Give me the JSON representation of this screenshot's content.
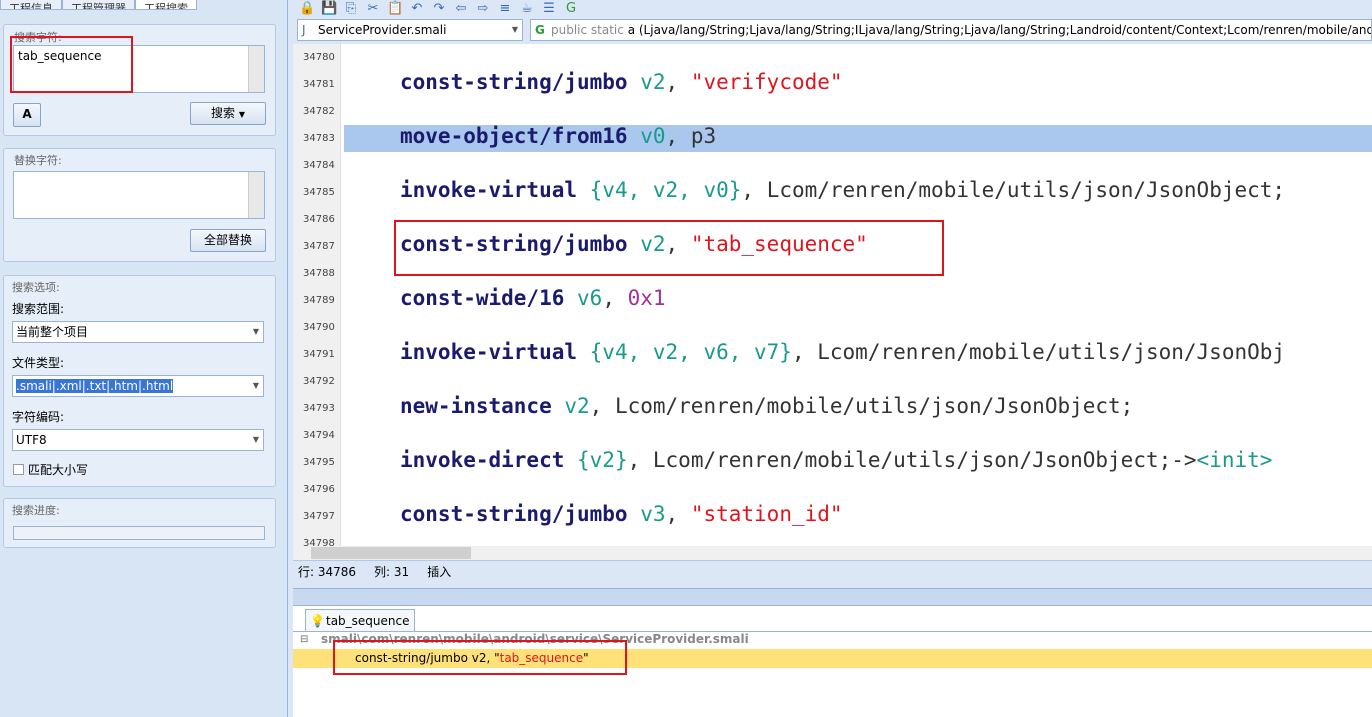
{
  "left_tabs": [
    "工程信息",
    "工程管理器",
    "工程搜索"
  ],
  "search": {
    "label": "搜索字符:",
    "value": "tab_sequence",
    "button": "搜索",
    "case_icon": "font-size-icon"
  },
  "replace": {
    "label": "替换字符:",
    "value": "",
    "button": "全部替换"
  },
  "options": {
    "label": "搜索选项:",
    "scope_label": "搜索范围:",
    "scope_value": "当前整个项目",
    "type_label": "文件类型:",
    "type_value": ".smali|.xml|.txt|.htm|.html",
    "encoding_label": "字符编码:",
    "encoding_value": "UTF8",
    "match_case": "匹配大小写"
  },
  "progress": {
    "label": "搜索进度:",
    "value": 0
  },
  "editor": {
    "file": "ServiceProvider.smali",
    "method_prefix": "public static",
    "method": "a (Ljava/lang/String;Ljava/lang/String;ILjava/lang/String;Ljava/lang/String;Landroid/content/Context;Lcom/renren/mobile/android/",
    "line_numbers": [
      "34780",
      "34781",
      "34782",
      "34783",
      "34784",
      "34785",
      "34786",
      "34787",
      "34788",
      "34789",
      "34790",
      "34791",
      "34792",
      "34793",
      "34794",
      "34795",
      "34796",
      "34797",
      "34798"
    ],
    "lines": [
      {
        "op": "const-string/jumbo",
        "a": " v2",
        ",": ", ",
        "s": "\"verifycode\""
      },
      {
        "op": "move-object/from16",
        "a": " v0",
        ",": ", ",
        "p": "p3"
      },
      {
        "op": "invoke-virtual",
        "b": " {v4, v2, v0}",
        ",": ", ",
        "p": "Lcom/renren/mobile/utils/json/JsonObject;"
      },
      {
        "op": "const-string/jumbo",
        "a": " v2",
        ",": ", ",
        "s": "\"tab_sequence\""
      },
      {
        "op": "const-wide/16",
        "a": " v6",
        ",": ", ",
        "n": "0x1"
      },
      {
        "op": "invoke-virtual",
        "b": " {v4, v2, v6, v7}",
        ",": ", ",
        "p": "Lcom/renren/mobile/utils/json/JsonObj"
      },
      {
        "op": "new-instance",
        "a": " v2",
        ",": ", ",
        "p": "Lcom/renren/mobile/utils/json/JsonObject;"
      },
      {
        "op": "invoke-direct",
        "b": " {v2}",
        ",": ", ",
        "p": "Lcom/renren/mobile/utils/json/JsonObject;->",
        "q": "<init>"
      },
      {
        "op": "const-string/jumbo",
        "a": " v3",
        ",": ", ",
        "s": "\"station_id\""
      }
    ]
  },
  "status": {
    "row": "行: 34786",
    "col": "列: 31",
    "mode": "插入"
  },
  "results": {
    "tab": "tab_sequence",
    "path": "smali\\com\\renren\\mobile\\android\\service\\ServiceProvider.smali",
    "match_prefix": "const-string/jumbo v2, \"",
    "match_hit": "tab_sequence",
    "match_suffix": "\""
  }
}
